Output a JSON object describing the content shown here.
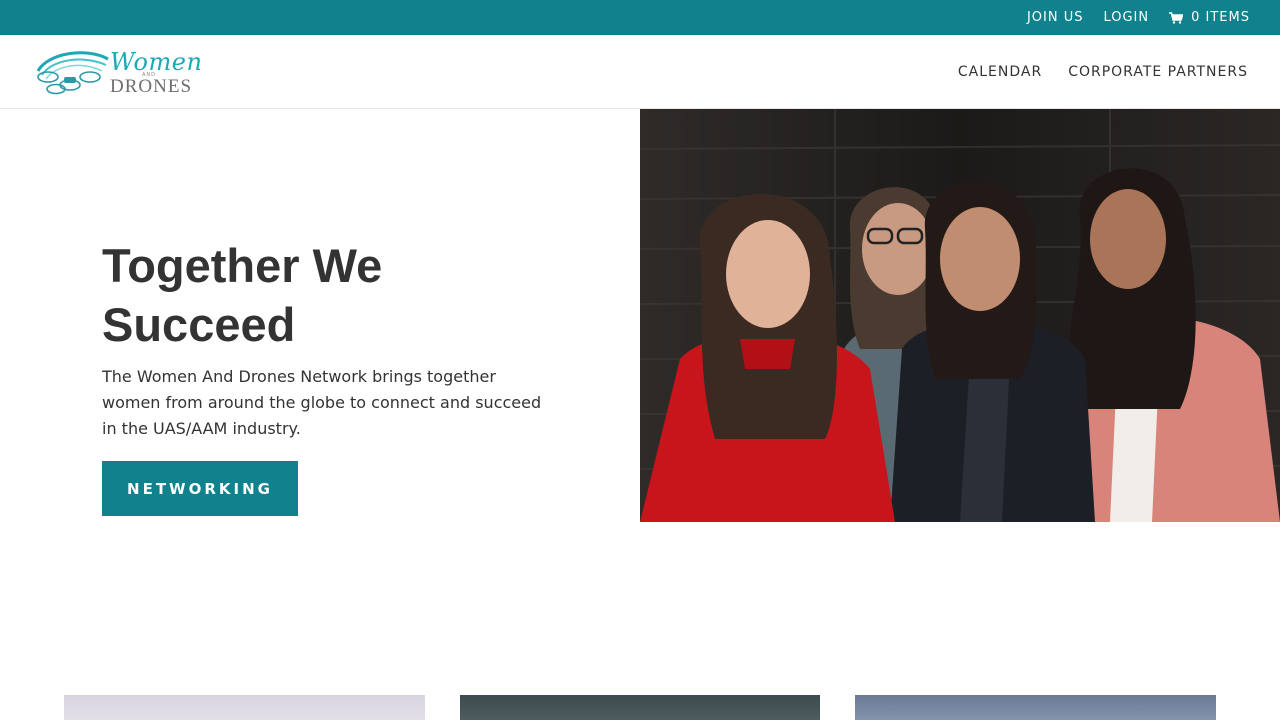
{
  "topbar": {
    "join_label": "JOIN US",
    "login_label": "LOGIN",
    "cart_label": "0 ITEMS",
    "cart_icon": "shopping-cart-icon",
    "background_color": "#0f828e"
  },
  "logo": {
    "line1": "Women",
    "line2": "AND",
    "line3": "DRONES",
    "mark_icon": "drone-swoosh-logo"
  },
  "nav": {
    "items": [
      {
        "label": "CALENDAR"
      },
      {
        "label": "CORPORATE PARTNERS"
      }
    ]
  },
  "hero": {
    "title": "Together We Succeed",
    "description": "The Women And Drones Network brings together women from around the globe to connect and succeed in the UAS/AAM industry.",
    "button_label": "NETWORKING",
    "accent_color": "#0f828e"
  }
}
